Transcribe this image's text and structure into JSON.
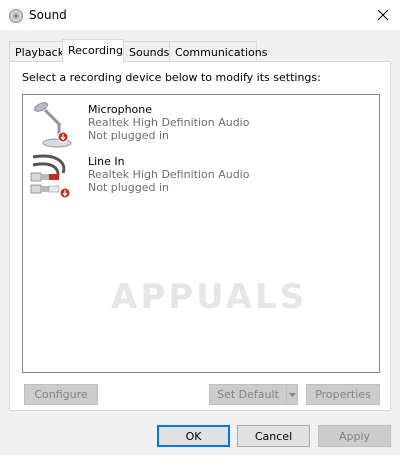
{
  "window": {
    "title": "Sound",
    "app_icon": "speaker-icon",
    "close_icon": "close-icon"
  },
  "tabs": [
    {
      "label": "Playback",
      "selected": false
    },
    {
      "label": "Recording",
      "selected": true
    },
    {
      "label": "Sounds",
      "selected": false
    },
    {
      "label": "Communications",
      "selected": false
    }
  ],
  "panel": {
    "instruction": "Select a recording device below to modify its settings:",
    "devices": [
      {
        "name": "Microphone",
        "driver": "Realtek High Definition Audio",
        "status": "Not plugged in",
        "icon": "microphone-icon",
        "status_icon": "unplugged-badge-icon"
      },
      {
        "name": "Line In",
        "driver": "Realtek High Definition Audio",
        "status": "Not plugged in",
        "icon": "line-in-cable-icon",
        "status_icon": "unplugged-badge-icon"
      }
    ],
    "watermark": "APPUALS",
    "buttons": {
      "configure": "Configure",
      "set_default": "Set Default",
      "properties": "Properties"
    }
  },
  "footer": {
    "ok": "OK",
    "cancel": "Cancel",
    "apply": "Apply"
  },
  "colors": {
    "focus_border": "#0078d7",
    "badge_red": "#c42b1c",
    "disabled_text": "#838383"
  }
}
